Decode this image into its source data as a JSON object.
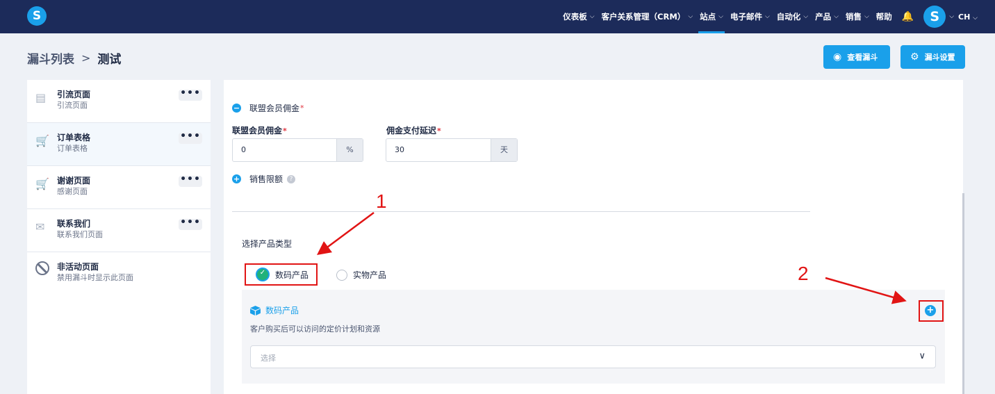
{
  "nav": {
    "items": [
      {
        "label": "仪表板",
        "has_dropdown": true
      },
      {
        "label": "客户关系管理（CRM）",
        "has_dropdown": true
      },
      {
        "label": "站点",
        "has_dropdown": true,
        "active": true
      },
      {
        "label": "电子邮件",
        "has_dropdown": true
      },
      {
        "label": "自动化",
        "has_dropdown": true
      },
      {
        "label": "产品",
        "has_dropdown": true
      },
      {
        "label": "销售",
        "has_dropdown": true
      },
      {
        "label": "帮助",
        "has_dropdown": false
      }
    ],
    "language": "CH",
    "logo_letter": "S",
    "avatar_letter": "S",
    "bell_icon": "bell-icon"
  },
  "breadcrumb": {
    "root": "漏斗列表",
    "separator": ">",
    "current": "测试"
  },
  "header_buttons": {
    "view_funnel": "查看漏斗",
    "funnel_settings": "漏斗设置"
  },
  "sidebar": {
    "steps": [
      {
        "title": "引流页面",
        "subtitle": "引流页面",
        "icon": "page-icon",
        "more": "•••"
      },
      {
        "title": "订单表格",
        "subtitle": "订单表格",
        "icon": "cart-icon",
        "more": "•••",
        "selected": true
      },
      {
        "title": "谢谢页面",
        "subtitle": "感谢页面",
        "icon": "cart-check-icon",
        "more": "•••"
      },
      {
        "title": "联系我们",
        "subtitle": "联系我们页面",
        "icon": "envelope-icon",
        "more": "•••"
      },
      {
        "title": "非活动页面",
        "subtitle": "禁用漏斗时显示此页面",
        "icon": "ban-icon"
      }
    ]
  },
  "form": {
    "affiliate_toggle": {
      "label": "联盟会员佣金",
      "required_mark": "*",
      "state": "expanded"
    },
    "commission": {
      "label": "联盟会员佣金",
      "required_mark": "*",
      "value": "0",
      "suffix": "%"
    },
    "payout_delay": {
      "label": "佣金支付延迟",
      "required_mark": "*",
      "value": "30",
      "suffix": "天"
    },
    "sales_limit": {
      "label": "销售限额",
      "help": "?",
      "state": "collapsed"
    },
    "product_type": {
      "label": "选择产品类型",
      "options": [
        {
          "label": "数码产品",
          "checked": true
        },
        {
          "label": "实物产品",
          "checked": false
        }
      ]
    },
    "digital_product": {
      "title": "数码产品",
      "description": "客户购买后可以访问的定价计划和资源",
      "select_placeholder": "选择"
    }
  },
  "annotations": {
    "label_1": "1",
    "label_2": "2",
    "color": "#e11414"
  },
  "colors": {
    "brand_blue": "#1aa0ea",
    "nav_bg": "#1c2b5a",
    "check_green": "#20b27a"
  }
}
